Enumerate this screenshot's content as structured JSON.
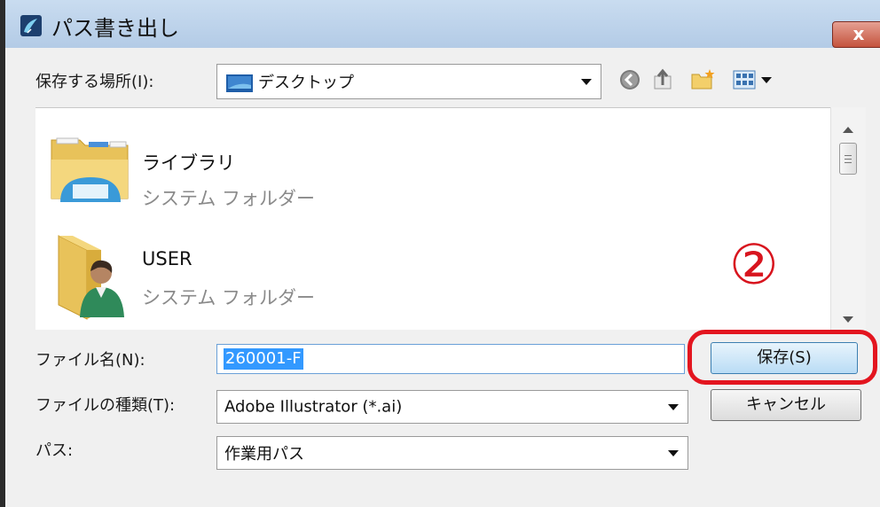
{
  "window": {
    "title": "パス書き出し",
    "close_label": "x"
  },
  "save_in": {
    "label": "保存する場所(I):",
    "value": "デスクトップ"
  },
  "file_list": [
    {
      "name": "ライブラリ",
      "type": "システム フォルダー",
      "icon": "library-folder-icon"
    },
    {
      "name": "USER",
      "type": "システム フォルダー",
      "icon": "user-folder-icon"
    }
  ],
  "annotation": {
    "step": "②",
    "color": "#e3151f"
  },
  "file_name": {
    "label": "ファイル名(N):",
    "value": "260001-F"
  },
  "file_type": {
    "label": "ファイルの種類(T):",
    "value": "Adobe Illustrator (*.ai)"
  },
  "path": {
    "label": "パス:",
    "value": "作業用パス"
  },
  "buttons": {
    "save": "保存(S)",
    "cancel": "キャンセル"
  },
  "toolbar_icons": [
    "back-icon",
    "up-folder-icon",
    "new-folder-icon",
    "view-menu-icon"
  ]
}
